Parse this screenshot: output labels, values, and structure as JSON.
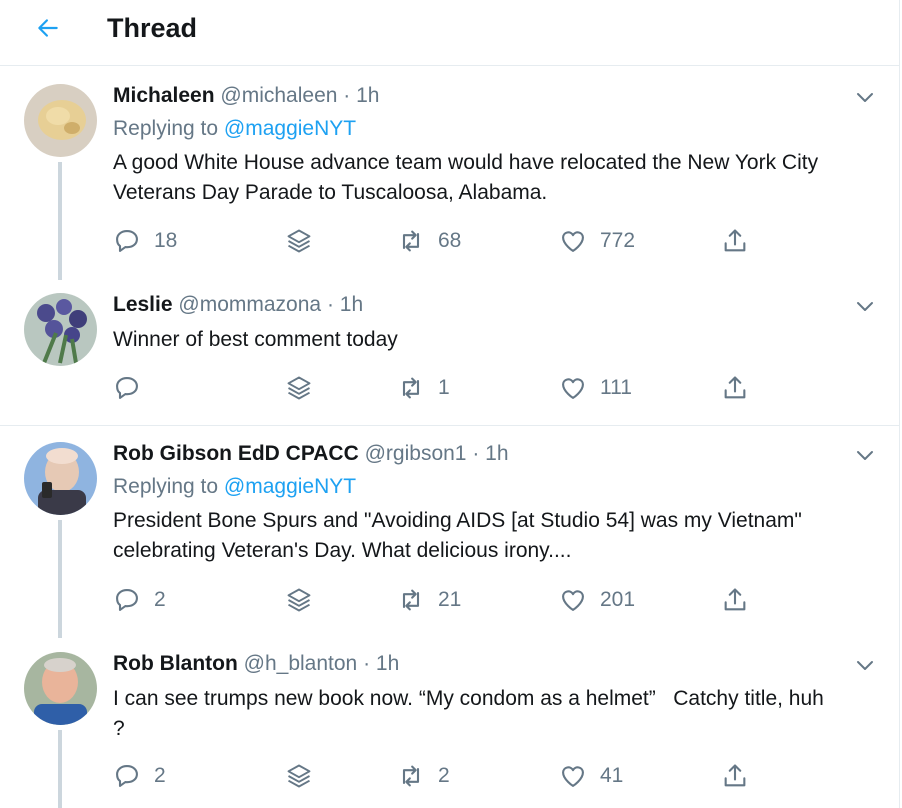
{
  "header": {
    "title": "Thread"
  },
  "tweets": [
    {
      "name": "Michaleen",
      "handle": "@michaleen",
      "dot": "·",
      "time": "1h",
      "replying_prefix": "Replying to ",
      "replying_to": "@maggieNYT",
      "text": "A good White House advance team would have relocated the New York City\nVeterans Day Parade to Tuscaloosa, Alabama.",
      "replies": "18",
      "retweets": "68",
      "likes": "772"
    },
    {
      "name": "Leslie",
      "handle": "@mommazona",
      "dot": "·",
      "time": "1h",
      "text": "Winner of best comment today",
      "replies": "",
      "retweets": "1",
      "likes": "111"
    },
    {
      "name": "Rob Gibson EdD CPACC",
      "handle": "@rgibson1",
      "dot": "·",
      "time": "1h",
      "replying_prefix": "Replying to ",
      "replying_to": "@maggieNYT",
      "text": "President Bone Spurs and \"Avoiding AIDS [at Studio 54] was my Vietnam\"\ncelebrating Veteran's Day. What delicious irony....",
      "replies": "2",
      "retweets": "21",
      "likes": "201"
    },
    {
      "name": "Rob Blanton",
      "handle": "@h_blanton",
      "dot": "·",
      "time": "1h",
      "text": "I can see trumps new book now. “My condom as a helmet”   Catchy title, huh\n?",
      "replies": "2",
      "retweets": "2",
      "likes": "41"
    }
  ],
  "icons": {
    "back": "arrow-left-icon",
    "caret": "chevron-down-icon",
    "reply": "reply-icon",
    "stack": "layers-icon",
    "retweet": "retweet-icon",
    "like": "heart-icon",
    "share": "share-icon"
  },
  "colors": {
    "accent": "#1da1f2",
    "muted": "#657786",
    "text": "#14171a",
    "divider": "#e6ecf0",
    "thread_line": "#ccd6dd"
  }
}
